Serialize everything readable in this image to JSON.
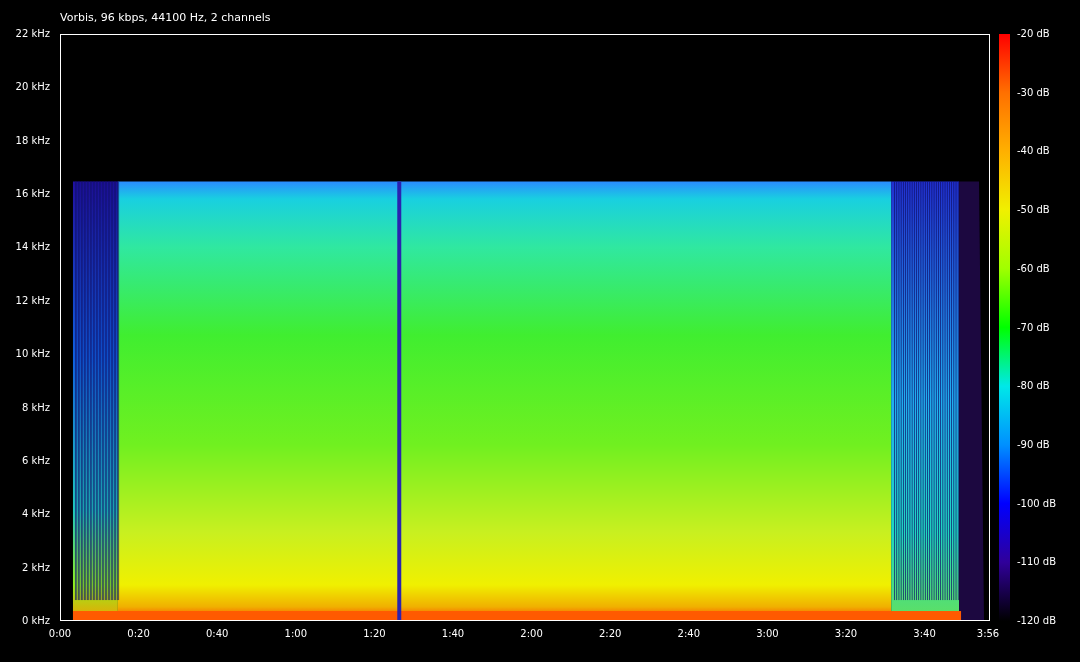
{
  "title": "Vorbis, 96 kbps, 44100 Hz, 2 channels",
  "frequency_axis": {
    "ticks": [
      "22 kHz",
      "20 kHz",
      "18 kHz",
      "16 kHz",
      "14 kHz",
      "12 kHz",
      "10 kHz",
      "8 kHz",
      "6 kHz",
      "4 kHz",
      "2 kHz",
      "0 kHz"
    ]
  },
  "time_axis": {
    "ticks": [
      "0:00",
      "0:20",
      "0:40",
      "1:00",
      "1:20",
      "1:40",
      "2:00",
      "2:20",
      "2:40",
      "3:00",
      "3:20",
      "3:40",
      "3:56"
    ]
  },
  "color_scale": {
    "ticks": [
      "-20 dB",
      "-30 dB",
      "-40 dB",
      "-50 dB",
      "-60 dB",
      "-70 dB",
      "-80 dB",
      "-90 dB",
      "-100 dB",
      "-110 dB",
      "-120 dB"
    ]
  }
}
